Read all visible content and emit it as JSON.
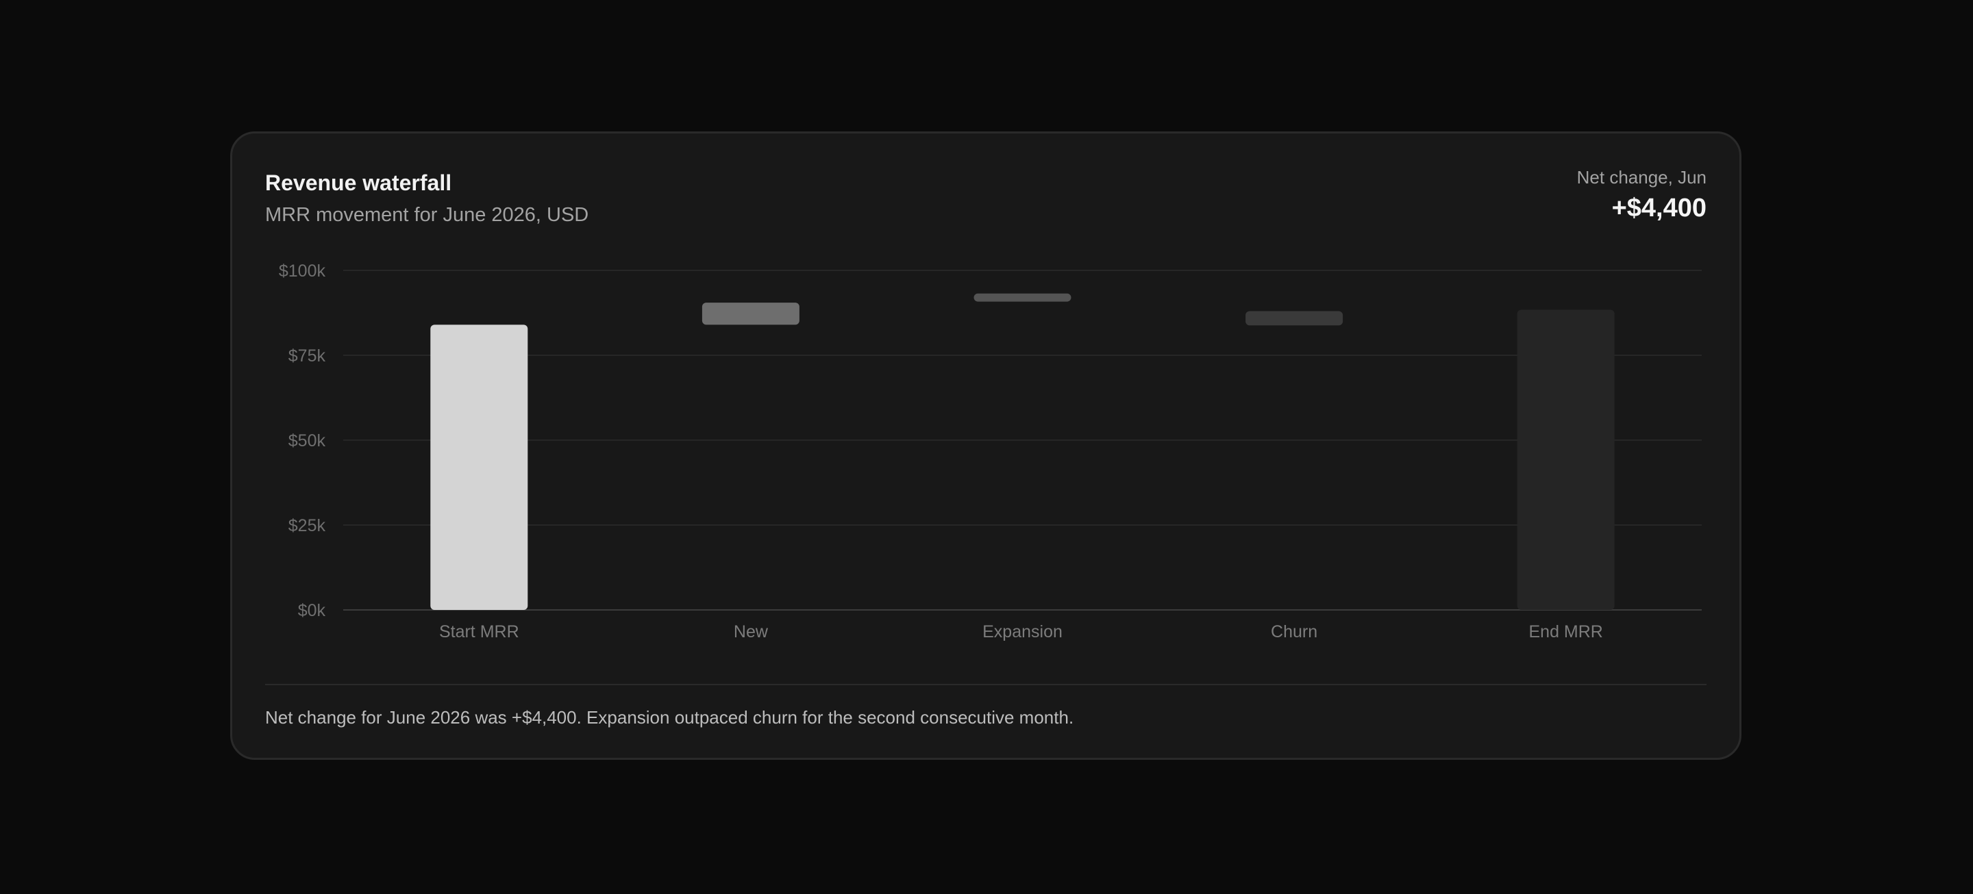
{
  "card": {
    "title": "Revenue waterfall",
    "subtitle": "MRR movement for June 2026, USD",
    "net_change_label": "Net change, Jun",
    "net_change_value": "+$4,400",
    "footnote": "Net change for June 2026 was +$4,400. Expansion outpaced churn for the second consecutive month."
  },
  "chart_data": {
    "type": "bar",
    "subtype": "waterfall",
    "title": "Revenue waterfall",
    "subtitle": "MRR movement for June 2026, USD",
    "categories": [
      "Start MRR",
      "New",
      "Expansion",
      "Churn",
      "End MRR"
    ],
    "bars": [
      {
        "label": "Start MRR",
        "base": 0,
        "top": 84000,
        "color": "#d4d4d4"
      },
      {
        "label": "New",
        "base": 84000,
        "top": 90500,
        "color": "#6e6e6e"
      },
      {
        "label": "Expansion",
        "base": 90800,
        "top": 93200,
        "color": "#545454"
      },
      {
        "label": "Churn",
        "base": 83800,
        "top": 88000,
        "color": "#3a3a3a"
      },
      {
        "label": "End MRR",
        "base": 0,
        "top": 88400,
        "color": "#252525"
      }
    ],
    "y_ticks": [
      {
        "value": 0,
        "label": "$0k"
      },
      {
        "value": 25000,
        "label": "$25k"
      },
      {
        "value": 50000,
        "label": "$50k"
      },
      {
        "value": 75000,
        "label": "$75k"
      },
      {
        "value": 100000,
        "label": "$100k"
      }
    ],
    "ylim": [
      0,
      100000
    ],
    "grid": true,
    "colors": {
      "grid": "#262626",
      "axis": "#3c3c3c",
      "tick_text": "#6f6f6f",
      "category_text": "#7c7c7c"
    }
  }
}
